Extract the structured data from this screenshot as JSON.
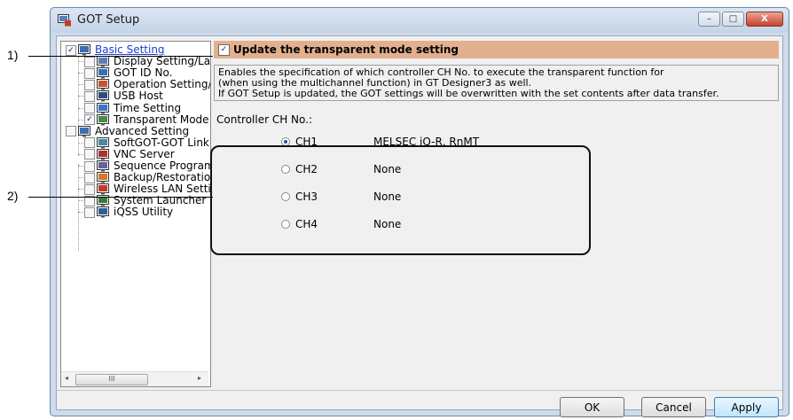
{
  "window": {
    "title": "GOT Setup",
    "controls": {
      "minimize": "–",
      "maximize": "□",
      "close": "X"
    }
  },
  "tree": {
    "items": [
      {
        "label": "Basic Setting",
        "checked": "✓",
        "icon": "basic-setting-icon",
        "level": 0,
        "link": true
      },
      {
        "label": "Display Setting/Lang",
        "checked": "",
        "icon": "display-icon",
        "level": 1
      },
      {
        "label": "GOT ID No.",
        "checked": "",
        "icon": "id-icon",
        "level": 1
      },
      {
        "label": "Operation Setting/U",
        "checked": "",
        "icon": "operation-icon",
        "level": 1
      },
      {
        "label": "USB Host",
        "checked": "",
        "icon": "usb-icon",
        "level": 1
      },
      {
        "label": "Time Setting",
        "checked": "",
        "icon": "clock-icon",
        "level": 1
      },
      {
        "label": "Transparent Mode S",
        "checked": "✓",
        "icon": "transparent-mode-icon",
        "level": 1
      },
      {
        "label": "Advanced Setting",
        "checked": "",
        "icon": "advanced-setting-icon",
        "level": 0
      },
      {
        "label": "SoftGOT-GOT Link",
        "checked": "",
        "icon": "link-icon",
        "level": 1
      },
      {
        "label": "VNC Server",
        "checked": "",
        "icon": "vnc-icon",
        "level": 1
      },
      {
        "label": "Sequence Program",
        "checked": "",
        "icon": "sequence-icon",
        "level": 1
      },
      {
        "label": "Backup/Restoration",
        "checked": "",
        "icon": "backup-icon",
        "level": 1
      },
      {
        "label": "Wireless LAN Setting",
        "checked": "",
        "icon": "wireless-icon",
        "level": 1
      },
      {
        "label": "System Launcher",
        "checked": "",
        "icon": "launcher-icon",
        "level": 1
      },
      {
        "label": "iQSS Utility",
        "checked": "",
        "icon": "iqss-icon",
        "level": 1
      }
    ],
    "scroll_left": "◂",
    "scroll_right": "▸",
    "scroll_grip": "III"
  },
  "main": {
    "header_checkbox": "✓",
    "header_label": "Update the transparent mode setting",
    "description": [
      "Enables the specification of which controller CH No. to execute the transparent function for",
      "(when using the multichannel function) in GT Designer3 as well.",
      "If GOT Setup is updated, the GOT settings will be overwritten with the set contents after data transfer."
    ],
    "group_label": "Controller CH No.:",
    "channels": [
      {
        "name": "CH1",
        "value": "MELSEC iQ-R, RnMT",
        "selected": true
      },
      {
        "name": "CH2",
        "value": "None",
        "selected": false
      },
      {
        "name": "CH3",
        "value": "None",
        "selected": false
      },
      {
        "name": "CH4",
        "value": "None",
        "selected": false
      }
    ]
  },
  "buttons": {
    "ok": "OK",
    "cancel": "Cancel",
    "apply": "Apply"
  },
  "callouts": {
    "c1": "1)",
    "c2": "2)"
  }
}
